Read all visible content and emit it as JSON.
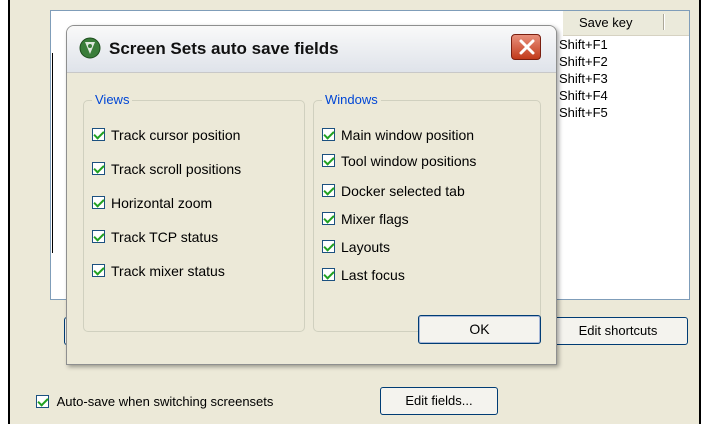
{
  "list": {
    "column_save_key": "Save key",
    "rows": [
      "Shift+F1",
      "Shift+F2",
      "Shift+F3",
      "Shift+F4",
      "Shift+F5"
    ]
  },
  "buttons": {
    "edit_shortcuts": "Edit shortcuts",
    "edit_fields": "Edit fields..."
  },
  "autosave": {
    "label": "Auto-save when switching screensets",
    "checked": true
  },
  "dialog": {
    "title": "Screen Sets auto save fields",
    "ok_label": "OK",
    "views": {
      "legend": "Views",
      "items": [
        {
          "label": "Track cursor position",
          "checked": true
        },
        {
          "label": "Track scroll positions",
          "checked": true
        },
        {
          "label": "Horizontal zoom",
          "checked": true
        },
        {
          "label": "Track TCP status",
          "checked": true
        },
        {
          "label": "Track mixer status",
          "checked": true
        }
      ]
    },
    "windows": {
      "legend": "Windows",
      "items": [
        {
          "label": "Main window position",
          "checked": true
        },
        {
          "label": "Tool window positions",
          "checked": true
        },
        {
          "label": "Docker selected tab",
          "checked": true
        },
        {
          "label": "Mixer flags",
          "checked": true
        },
        {
          "label": "Layouts",
          "checked": true
        },
        {
          "label": "Last focus",
          "checked": true
        }
      ]
    }
  },
  "colors": {
    "accent": "#0046d5",
    "check": "#21a121",
    "close_button": "#c23a1b"
  }
}
